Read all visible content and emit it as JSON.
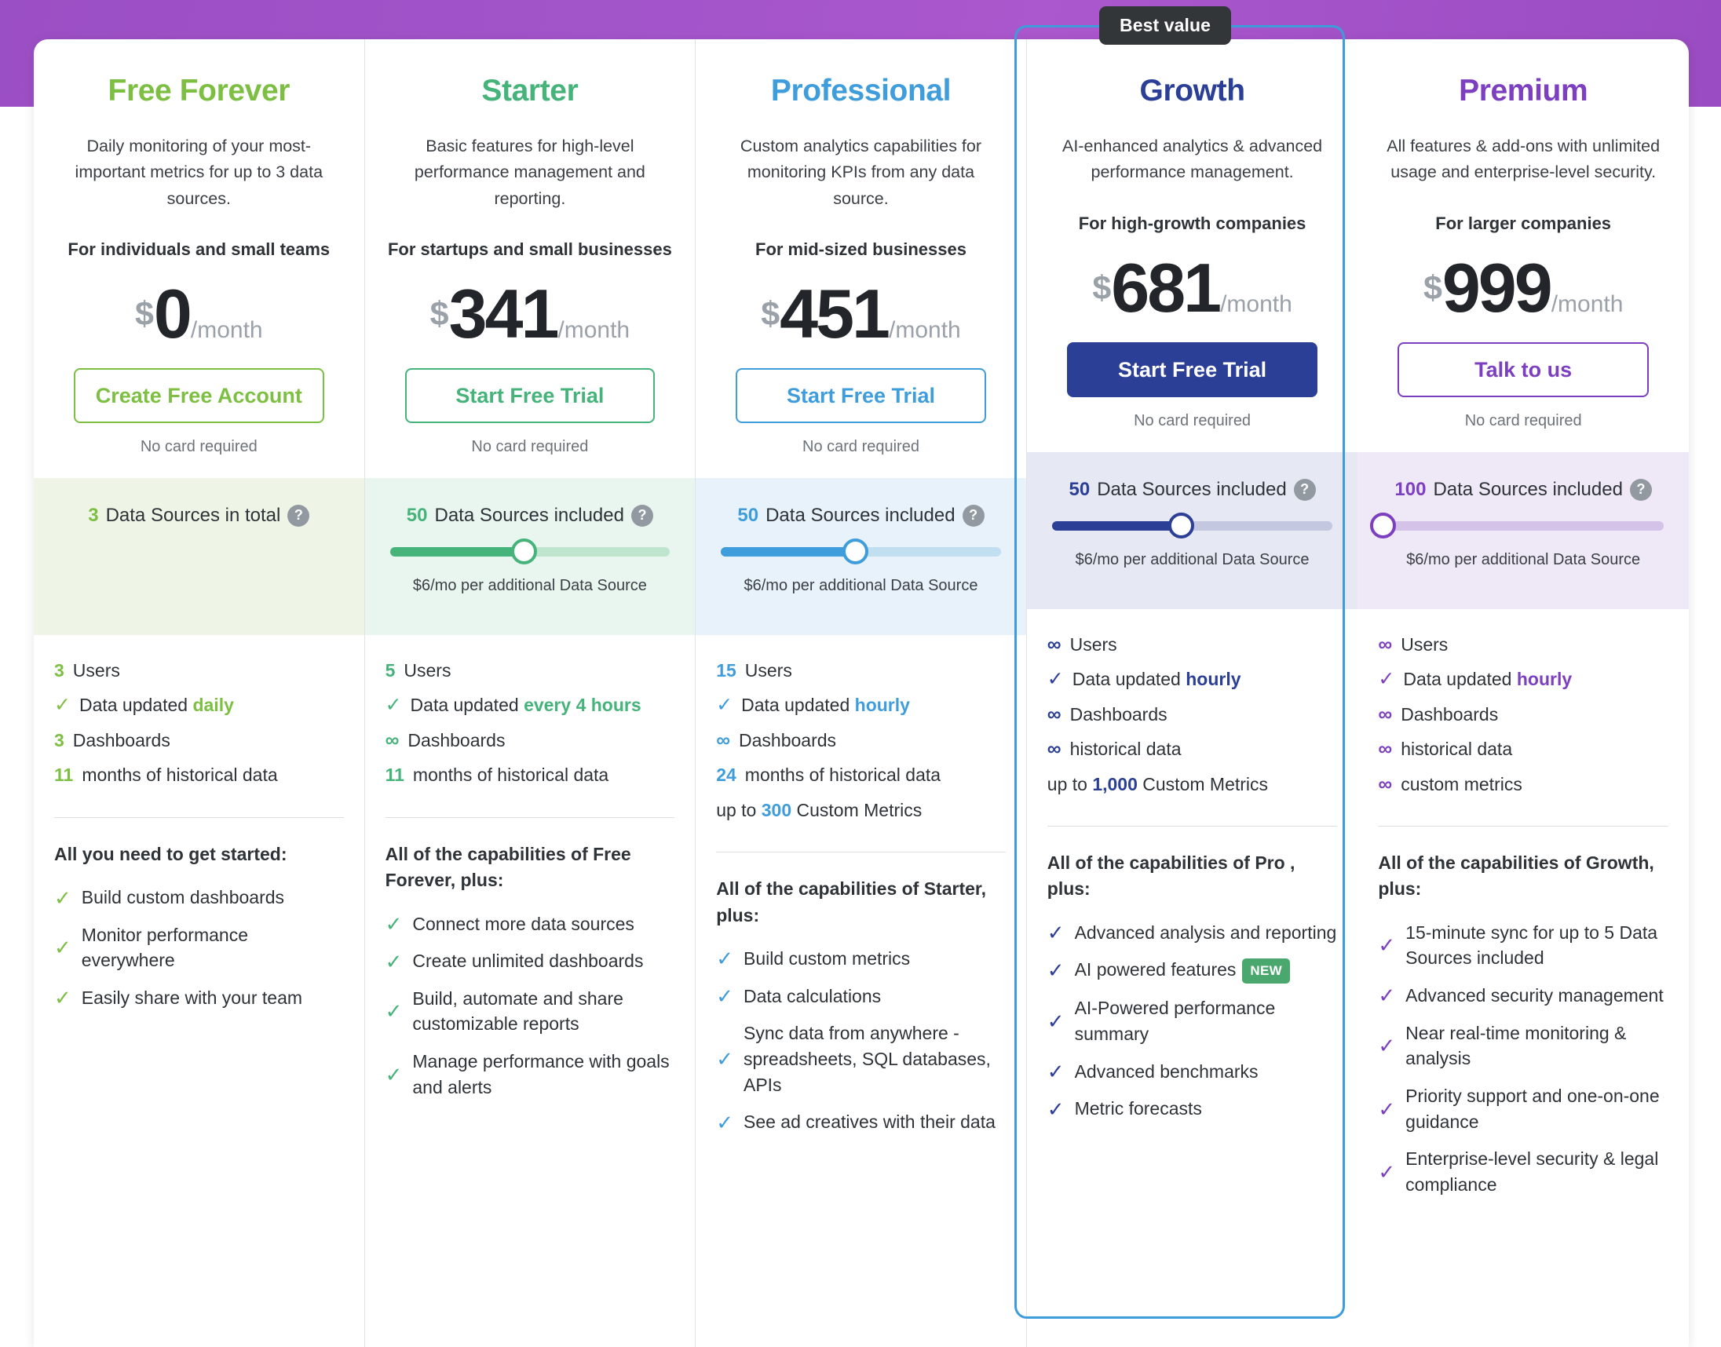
{
  "badge": {
    "best_value": "Best value"
  },
  "icons": {
    "help": "?",
    "check": "✓",
    "infinity": "∞"
  },
  "common": {
    "no_card": "No card required",
    "per_month": "/month",
    "currency": "$",
    "ds_note": "$6/mo per additional Data Source",
    "ds_included_suffix": "Data Sources included",
    "ds_total_suffix": "Data Sources in total",
    "new_badge": "NEW"
  },
  "colors": {
    "free": "#7dbf42",
    "starter": "#45b37a",
    "professional": "#3f9ddb",
    "growth": "#2b3f96",
    "premium": "#7b3fbf",
    "band_free": "#eef5e6",
    "band_starter": "#e9f6ef",
    "band_professional": "#e7f2fa",
    "band_growth": "#e6e8f4",
    "band_premium": "#efe8f7",
    "badge_bg": "#333638",
    "new_badge_bg": "#4aa86f",
    "featured_border": "#3d9ddb",
    "purple_band": "#a254c9"
  },
  "plans": [
    {
      "id": "free-forever",
      "name": "Free Forever",
      "description": "Daily monitoring of your most-important metrics for up to 3 data sources.",
      "audience": "For individuals and small teams",
      "price": "0",
      "cta_label": "Create Free Account",
      "cta_style": "outline",
      "data_sources": {
        "count": "3",
        "label_suffix": "Data Sources in total",
        "has_slider": false,
        "note": ""
      },
      "specs": [
        {
          "lead": "3",
          "type": "number",
          "text": "Users"
        },
        {
          "lead": "check",
          "type": "check",
          "text": "Data updated ",
          "accent": "daily"
        },
        {
          "lead": "3",
          "type": "number",
          "text": "Dashboards"
        },
        {
          "lead": "11",
          "type": "number",
          "text": "months of historical data"
        }
      ],
      "plus_heading": "All you need to get started:",
      "features": [
        {
          "text": "Build custom dashboards"
        },
        {
          "text": "Monitor performance everywhere"
        },
        {
          "text": "Easily share with your team"
        }
      ]
    },
    {
      "id": "starter",
      "name": "Starter",
      "description": "Basic features for high-level performance management and reporting.",
      "audience": "For startups and small businesses",
      "price": "341",
      "cta_label": "Start Free Trial",
      "cta_style": "outline",
      "data_sources": {
        "count": "50",
        "label_suffix": "Data Sources included",
        "has_slider": true,
        "fill_pct": 48,
        "note": "$6/mo per additional Data Source"
      },
      "specs": [
        {
          "lead": "5",
          "type": "number",
          "text": "Users"
        },
        {
          "lead": "check",
          "type": "check",
          "text": "Data updated ",
          "accent": "every 4 hours"
        },
        {
          "lead": "inf",
          "type": "infinity",
          "text": "Dashboards"
        },
        {
          "lead": "11",
          "type": "number",
          "text": "months of historical data"
        }
      ],
      "plus_heading": "All of the capabilities of Free Forever, plus:",
      "features": [
        {
          "text": "Connect more data sources"
        },
        {
          "text": "Create unlimited dashboards"
        },
        {
          "text": "Build, automate and share customizable reports"
        },
        {
          "text": "Manage performance with goals and alerts"
        }
      ]
    },
    {
      "id": "professional",
      "name": "Professional",
      "description": "Custom analytics capabilities for monitoring KPIs from any data source.",
      "audience": "For mid-sized businesses",
      "price": "451",
      "cta_label": "Start Free Trial",
      "cta_style": "outline",
      "data_sources": {
        "count": "50",
        "label_suffix": "Data Sources included",
        "has_slider": true,
        "fill_pct": 48,
        "note": "$6/mo per additional Data Source"
      },
      "specs": [
        {
          "lead": "15",
          "type": "number",
          "text": "Users"
        },
        {
          "lead": "check",
          "type": "check",
          "text": "Data updated ",
          "accent": "hourly"
        },
        {
          "lead": "inf",
          "type": "infinity",
          "text": "Dashboards"
        },
        {
          "lead": "24",
          "type": "number",
          "text": "months of historical data"
        },
        {
          "lead": "",
          "type": "prefix",
          "prefix": "up to ",
          "accent": "300",
          "text": " Custom Metrics"
        }
      ],
      "plus_heading": "All of the capabilities of Starter, plus:",
      "features": [
        {
          "text": "Build custom metrics"
        },
        {
          "text": "Data calculations"
        },
        {
          "text": "Sync data from anywhere - spreadsheets, SQL databases, APIs"
        },
        {
          "text": "See ad creatives with their data"
        }
      ]
    },
    {
      "id": "growth",
      "name": "Growth",
      "description": "AI-enhanced analytics & advanced performance management.",
      "audience": "For high-growth companies",
      "price": "681",
      "cta_label": "Start Free Trial",
      "cta_style": "solid",
      "featured": true,
      "data_sources": {
        "count": "50",
        "label_suffix": "Data Sources included",
        "has_slider": true,
        "fill_pct": 46,
        "note": "$6/mo per additional Data Source"
      },
      "specs": [
        {
          "lead": "inf",
          "type": "infinity",
          "text": "Users"
        },
        {
          "lead": "check",
          "type": "check",
          "text": "Data updated ",
          "accent": "hourly"
        },
        {
          "lead": "inf",
          "type": "infinity",
          "text": "Dashboards"
        },
        {
          "lead": "inf",
          "type": "infinity",
          "text": "historical data"
        },
        {
          "lead": "",
          "type": "prefix",
          "prefix": "up to ",
          "accent": "1,000",
          "text": " Custom Metrics"
        }
      ],
      "plus_heading": "All of the capabilities of Pro , plus:",
      "features": [
        {
          "text": "Advanced analysis and reporting"
        },
        {
          "text": "AI powered features",
          "badge": "NEW"
        },
        {
          "text": "AI-Powered performance summary"
        },
        {
          "text": "Advanced benchmarks"
        },
        {
          "text": "Metric forecasts"
        }
      ]
    },
    {
      "id": "premium",
      "name": "Premium",
      "description": "All features & add-ons with unlimited usage and enterprise-level security.",
      "audience": "For larger companies",
      "price": "999",
      "cta_label": "Talk to us",
      "cta_style": "outline",
      "data_sources": {
        "count": "100",
        "label_suffix": "Data Sources included",
        "has_slider": true,
        "fill_pct": 0,
        "note": "$6/mo per additional Data Source"
      },
      "specs": [
        {
          "lead": "inf",
          "type": "infinity",
          "text": "Users"
        },
        {
          "lead": "check",
          "type": "check",
          "text": "Data updated ",
          "accent": "hourly"
        },
        {
          "lead": "inf",
          "type": "infinity",
          "text": "Dashboards"
        },
        {
          "lead": "inf",
          "type": "infinity",
          "text": "historical data"
        },
        {
          "lead": "inf",
          "type": "infinity",
          "text": "custom metrics"
        }
      ],
      "plus_heading": "All of the capabilities of Growth, plus:",
      "features": [
        {
          "text": "15-minute sync for up to 5 Data Sources included"
        },
        {
          "text": "Advanced security management"
        },
        {
          "text": "Near real-time monitoring & analysis"
        },
        {
          "text": "Priority support and one-on-one guidance"
        },
        {
          "text": "Enterprise-level security & legal compliance"
        }
      ]
    }
  ]
}
